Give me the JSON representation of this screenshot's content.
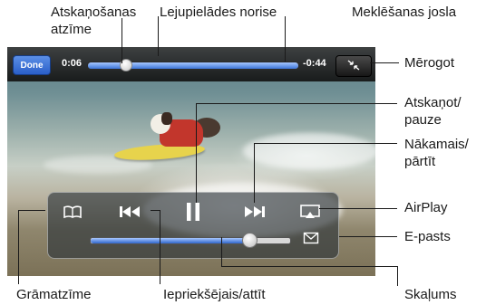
{
  "player": {
    "done_label": "Done",
    "time_elapsed": "0:06",
    "time_remaining": "-0:44",
    "playback_progress": 0.14,
    "download_progress": 1.0,
    "volume_level": 0.8,
    "accent_color": "#3c74d8",
    "icons": {
      "scale": "scale-icon",
      "bookmark": "book-icon",
      "previous": "previous-rewind-icon",
      "play_pause": "pause-icon",
      "next": "next-fast-forward-icon",
      "airplay": "airplay-icon",
      "email": "envelope-icon"
    }
  },
  "callouts": {
    "playhead": "Atskaņošanas\natzīme",
    "download_progress": "Lejupielādes norise",
    "scrubber_bar": "Meklēšanas josla",
    "scale": "Mērogot",
    "play_pause": "Atskaņot/\npauze",
    "next": "Nākamais/\npārtīt",
    "airplay": "AirPlay",
    "email": "E-pasts",
    "bookmark": "Grāmatzīme",
    "previous": "Iepriekšējais/attīt",
    "volume": "Skaļums"
  }
}
